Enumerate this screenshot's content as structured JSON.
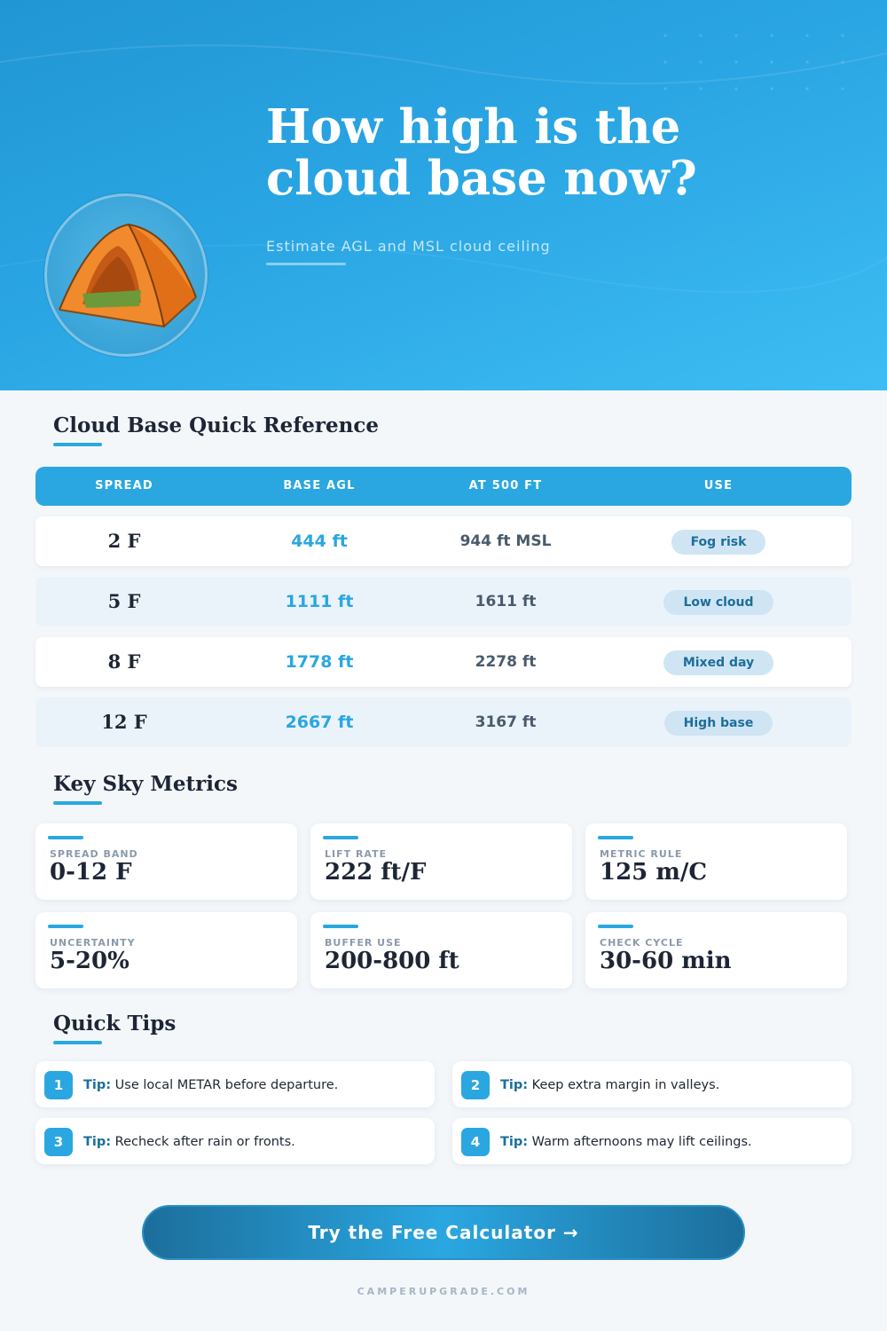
{
  "hero": {
    "title_line1": "How high is the",
    "title_line2": "cloud base now?",
    "subtitle": "Estimate AGL and MSL cloud ceiling",
    "icon": "tent-icon"
  },
  "reference": {
    "title": "Cloud Base Quick Reference",
    "headers": [
      "SPREAD",
      "BASE AGL",
      "AT 500 FT",
      "USE"
    ],
    "rows": [
      {
        "spread": "2 F",
        "agl": "444 ft",
        "msl": "944 ft MSL",
        "use": "Fog risk"
      },
      {
        "spread": "5 F",
        "agl": "1111 ft",
        "msl": "1611 ft",
        "use": "Low cloud"
      },
      {
        "spread": "8 F",
        "agl": "1778 ft",
        "msl": "2278 ft",
        "use": "Mixed day"
      },
      {
        "spread": "12 F",
        "agl": "2667 ft",
        "msl": "3167 ft",
        "use": "High base"
      }
    ]
  },
  "metrics": {
    "title": "Key Sky Metrics",
    "items": [
      {
        "label": "SPREAD BAND",
        "value": "0-12 F"
      },
      {
        "label": "LIFT RATE",
        "value": "222 ft/F"
      },
      {
        "label": "METRIC RULE",
        "value": "125 m/C"
      },
      {
        "label": "UNCERTAINTY",
        "value": "5-20%"
      },
      {
        "label": "BUFFER USE",
        "value": "200-800 ft"
      },
      {
        "label": "CHECK CYCLE",
        "value": "30-60 min"
      }
    ]
  },
  "tips": {
    "title": "Quick Tips",
    "prefix": "Tip:",
    "items": [
      {
        "num": "1",
        "text": "Use local METAR before departure."
      },
      {
        "num": "2",
        "text": "Keep extra margin in valleys."
      },
      {
        "num": "3",
        "text": "Recheck after rain or fronts."
      },
      {
        "num": "4",
        "text": "Warm afternoons may lift ceilings."
      }
    ]
  },
  "cta": {
    "label": "Try the Free Calculator →"
  },
  "footer": {
    "site": "CAMPERUPGRADE.COM"
  },
  "colors": {
    "accent": "#2aa7e1",
    "dark_accent": "#1d6e9a",
    "pill_bg": "#cfe5f4",
    "hero_top": "#2196d4",
    "hero_bottom": "#3dbdf3"
  }
}
